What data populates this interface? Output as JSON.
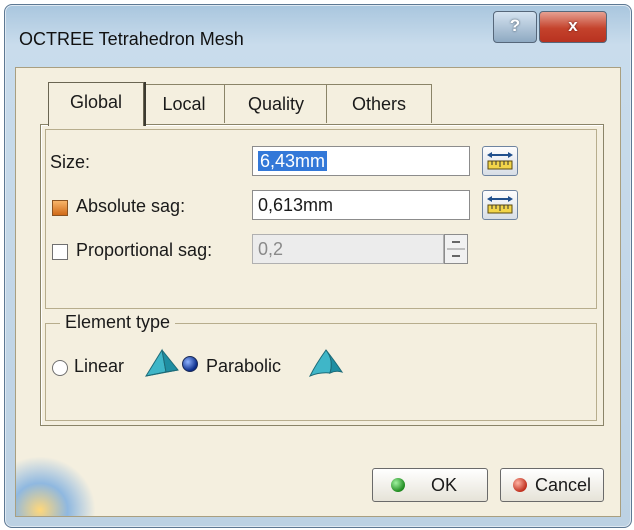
{
  "window": {
    "title": "OCTREE Tetrahedron Mesh",
    "help_label": "?",
    "close_label": "x"
  },
  "tabs": [
    {
      "label": "Global",
      "active": true
    },
    {
      "label": "Local",
      "active": false
    },
    {
      "label": "Quality",
      "active": false
    },
    {
      "label": "Others",
      "active": false
    }
  ],
  "global": {
    "size_label": "Size:",
    "size_value": "6,43mm",
    "absolute_sag_label": "Absolute sag:",
    "absolute_sag_checked": true,
    "absolute_sag_value": "0,613mm",
    "proportional_sag_label": "Proportional sag:",
    "proportional_sag_checked": false,
    "proportional_sag_value": "0,2",
    "proportional_sag_enabled": false
  },
  "element_type": {
    "legend": "Element type",
    "options": [
      {
        "label": "Linear",
        "selected": false
      },
      {
        "label": "Parabolic",
        "selected": true
      }
    ]
  },
  "buttons": {
    "ok_label": "OK",
    "cancel_label": "Cancel"
  },
  "colors": {
    "ok_dot": "#2fa32f",
    "cancel_dot": "#d13a2a",
    "selection": "#3378d8",
    "check_on": "#e07d2a"
  },
  "icons": [
    "measure-ruler-icon",
    "linear-tetrahedron-icon",
    "parabolic-tetrahedron-icon"
  ]
}
